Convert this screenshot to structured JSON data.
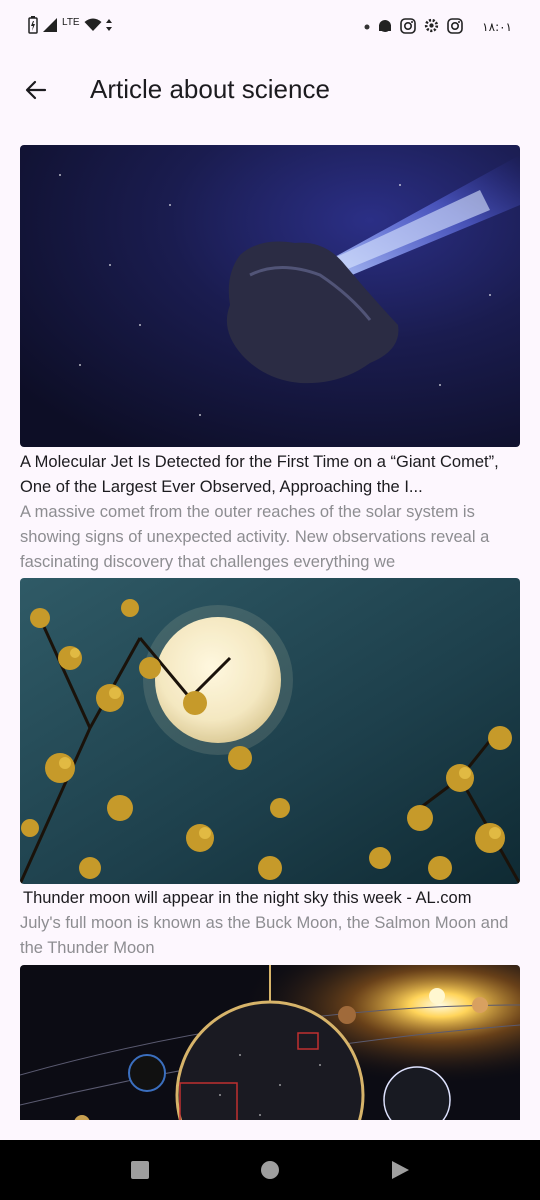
{
  "status_bar": {
    "network": "LTE",
    "time": "١٨:٠١"
  },
  "app_bar": {
    "title": "Article about science",
    "back_icon": "arrow-left-icon"
  },
  "articles": [
    {
      "image": "comet-in-space",
      "headline": "A Molecular Jet Is Detected for the First Time on a “Giant Comet”, One of the Largest Ever Observed, Approaching the I...",
      "description": "A massive comet from the outer reaches of the solar system is showing signs of unexpected activity. New observations reveal a fascinating discovery that challenges everything we"
    },
    {
      "image": "full-moon-with-blossoms",
      "headline": "Thunder moon will appear in the night sky this week - AL.com",
      "description": "July's full moon is known as the Buck Moon, the Salmon Moon and the Thunder Moon"
    },
    {
      "image": "solar-system-illustration",
      "headline": "",
      "description": ""
    }
  ],
  "nav_bar": {
    "recents_icon": "square-icon",
    "home_icon": "circle-icon",
    "back_icon": "triangle-icon"
  }
}
